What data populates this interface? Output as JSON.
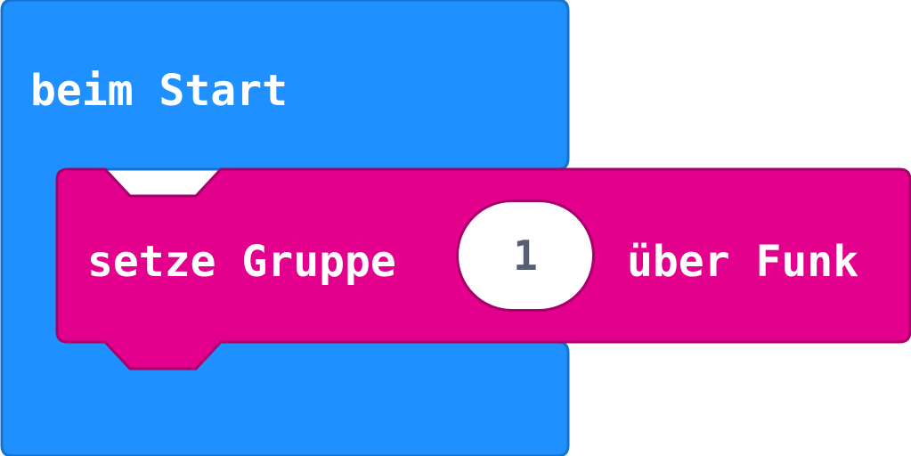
{
  "on_start_block": {
    "label": "beim Start",
    "color": "#1e90ff"
  },
  "radio_set_group_block": {
    "label_prefix": "setze Gruppe",
    "group_value": "1",
    "label_suffix": "über Funk",
    "color": "#e3008c"
  }
}
